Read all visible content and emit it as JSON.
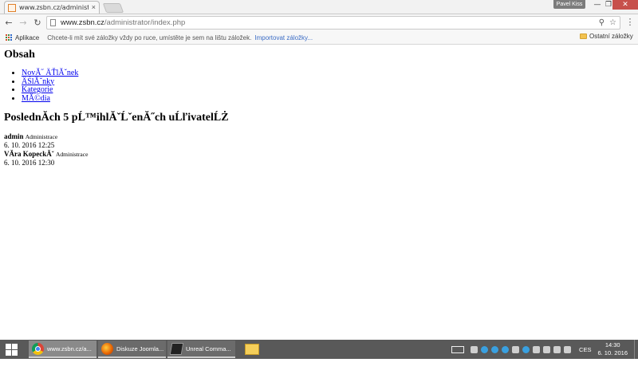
{
  "browser": {
    "tab": {
      "title": "www.zsbn.cz/administrator",
      "close": "×"
    },
    "profile": "Pavel Kiss",
    "window_controls": {
      "minimize": "—",
      "maximize": "❐",
      "close": "✕"
    },
    "nav": {
      "back": "←",
      "forward": "→",
      "reload": "↻"
    },
    "address": {
      "host": "www.zsbn.cz",
      "path": "/administrator/index.php"
    },
    "omnibox_icons": {
      "zoom": "⚲",
      "star": "☆"
    },
    "menu": "⋮",
    "bookmarks": {
      "apps": "Aplikace",
      "hint": "Chcete-li mít své záložky vždy po ruce, umístěte je sem na lištu záložek.",
      "import": "Importovat záložky...",
      "other": "Ostatní záložky"
    }
  },
  "page": {
    "heading": "Obsah",
    "menu": [
      "NovĂ˝ ÄŤlĂˇnek",
      "ÄŚlĂˇnky",
      "Kategorie",
      "MĂ©dia"
    ],
    "users_heading": "PoslednĂch 5 pĹ™ihlĂˇĹˇenĂ˝ch uĹľivatelĹŻ",
    "users": [
      {
        "name": "admin",
        "role": "Administrace",
        "time": "6. 10. 2016 12:25"
      },
      {
        "name": "VĂ­ra KopeckĂˇ",
        "role": "Administrace",
        "time": "6. 10. 2016 12:30"
      }
    ]
  },
  "taskbar": {
    "tasks": [
      {
        "label": "www.zsbn.cz/a...",
        "icon": "chrome-icon"
      },
      {
        "label": "Diskuze Joomla...",
        "icon": "firefox-icon"
      },
      {
        "label": "Unreal Comma...",
        "icon": "unreal-icon"
      }
    ],
    "language": "CES",
    "clock": {
      "time": "14:30",
      "date": "6. 10. 2016"
    }
  }
}
